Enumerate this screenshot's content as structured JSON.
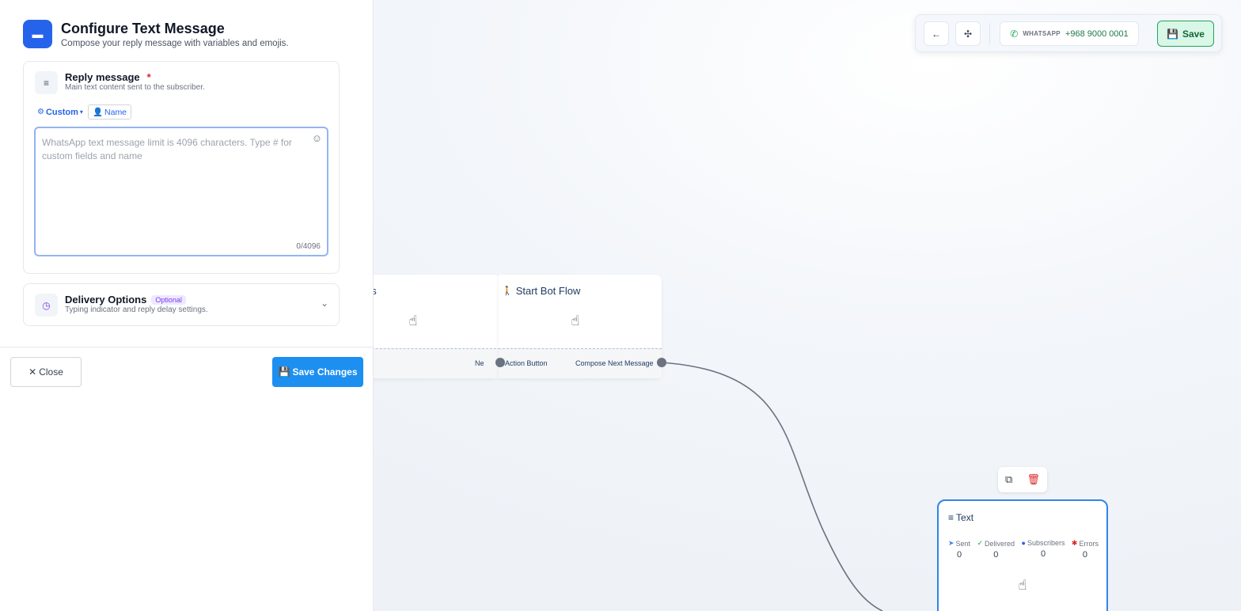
{
  "panel": {
    "title": "Configure Text Message",
    "subtitle": "Compose your reply message with variables and emojis.",
    "reply": {
      "title": "Reply message",
      "required_mark": "*",
      "subtitle": "Main text content sent to the subscriber.",
      "custom_label": "Custom",
      "name_label": "Name",
      "message_value": "",
      "placeholder": "WhatsApp text message limit is 4096 characters. Type # for custom fields and name",
      "char_count": "0/4096"
    },
    "delivery": {
      "title": "Delivery Options",
      "badge": "Optional",
      "subtitle": "Typing indicator and reply delay settings."
    },
    "close_label": "Close",
    "save_changes_label": "Save Changes"
  },
  "toolbar": {
    "whatsapp_label": "WHATSAPP",
    "phone_number": "+968 9000 0001",
    "save_label": "Save"
  },
  "canvas": {
    "node_a": {
      "title_fragment": "ns",
      "footer_next": "Ne",
      "footer_action": "Action Button"
    },
    "node_b": {
      "title": "Start Bot Flow",
      "footer_compose": "Compose Next Message"
    },
    "text_node": {
      "title": "Text",
      "stats": [
        {
          "label": "Sent",
          "value": "0",
          "icon": "send-icon",
          "color": "#3b82f6"
        },
        {
          "label": "Delivered",
          "value": "0",
          "icon": "check-circle-icon",
          "color": "#16a34a"
        },
        {
          "label": "Subscribers",
          "value": "0",
          "icon": "user-circle-icon",
          "color": "#2563eb"
        },
        {
          "label": "Errors",
          "value": "0",
          "icon": "bug-icon",
          "color": "#dc2626"
        }
      ]
    }
  },
  "colors": {
    "primary": "#2563eb",
    "save_button": "#1d8ff0",
    "whatsapp_green": "#22a65b",
    "danger": "#dc2626",
    "node_selected_border": "#2f86e6"
  }
}
